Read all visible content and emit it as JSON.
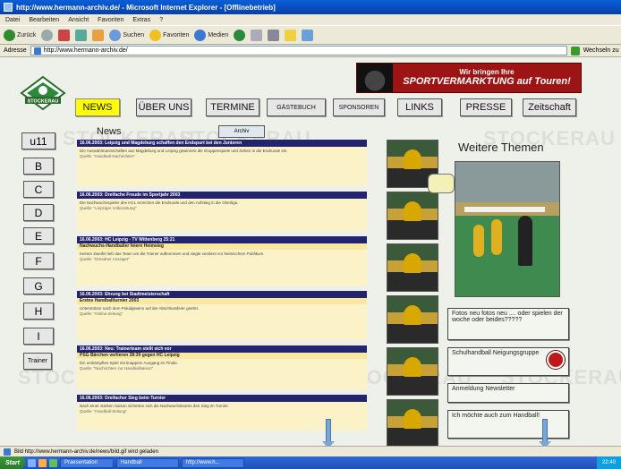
{
  "window": {
    "title": "http://www.hermann-archiv.de/ - Microsoft Internet Explorer - [Offlinebetrieb]",
    "menu": [
      "Datei",
      "Bearbeiten",
      "Ansicht",
      "Favoriten",
      "Extras",
      "?"
    ],
    "toolbar": [
      "Zurück",
      "Suchen",
      "Favoriten",
      "Medien"
    ],
    "address_label": "Adresse",
    "address_value": "http://www.hermann-archiv.de/",
    "links_label": "Wechseln zu"
  },
  "banner": {
    "line1": "Wir bringen Ihre",
    "line2": "SPORTVERMARKTUNG auf Touren!"
  },
  "logo": {
    "text": "STOCKERAU"
  },
  "watermark": "STOCKERAU",
  "nav": [
    "NEWS",
    "ÜBER UNS",
    "TERMINE",
    "GÄSTEBUCH",
    "SPONSOREN",
    "LINKS",
    "PRESSE",
    "Zeitschaft"
  ],
  "sidebar": [
    "u11",
    "B",
    "C",
    "D",
    "E",
    "F",
    "G",
    "H",
    "I",
    "Trainer"
  ],
  "news": {
    "heading": "News",
    "archive_button": "Archiv",
    "items": [
      {
        "head": "16.06.2003: Leipzig und Magdeburg schaffen den Endspurt bei den Junioren",
        "sub": "",
        "body": "Die Auswahlmannschaften aus Magdeburg und Leipzig gewinnen die Gruppenspiele und ziehen in die Endrunde ein.",
        "src": "Quelle: \"Handball-Nachrichten\""
      },
      {
        "head": "16.06.2003: Dreifache Freude im Sportjahr 2003",
        "sub": "",
        "body": "Die Nachwuchsspieler des HCL erreichen die Endrunde und den Aufstieg in die Oberliga.",
        "src": "Quelle: \"Leipziger Volkszeitung\""
      },
      {
        "head": "16.06.2003: HC Leipzig - TV Wittenberg 25:21",
        "sub": "Nachwuchs-Handballer feiern Heimsieg",
        "body": "Keinen Zweifel ließ das Team um die Trainer aufkommen und siegte verdient vor heimischem Publikum.",
        "src": "Quelle: \"Dresdner Anzeiger\""
      },
      {
        "head": "16.06.2003: Ehrung bei Stadtmeisterschaft",
        "sub": "Erstes Handballturnier 2003",
        "body": "Unterstützer nach dem Pokalgewinn auf der Abschlussfeier geehrt.",
        "src": "Quelle: \"Online-Zeitung\""
      },
      {
        "head": "16.06.2003: Neu: Trainerteam stellt sich vor",
        "sub": "PSG Bärchen verlieren 28:30 gegen HC Leipzig",
        "body": "Ein umkämpftes Spiel mit knappem Ausgang im Finale.",
        "src": "Quelle: \"Nachrichten zur Handballsaison\""
      },
      {
        "head": "16.06.2003: Dreifacher Sieg beim Turnier",
        "sub": "",
        "body": "Nach einer starken Saison sicherten sich die Nachwuchsteams den Sieg im Turnier.",
        "src": "Quelle: \"Handball-Zeitung\""
      }
    ]
  },
  "weitere_themen": "Weitere Themen",
  "linkboxes": [
    "Fotos neu fotos neu .... oder spielen der woche oder beides?????",
    "Schulhandball Neigungsgruppe",
    "Anmeldung Newsletter",
    "Ich möchte auch zum Handball!"
  ],
  "statusbar": {
    "text": "Bild http://www.hermann-archiv.de/news/bild.gif wird geladen"
  },
  "taskbar": {
    "start": "Start",
    "tasks": [
      "Praesentation",
      "Handball",
      "http://www.h..."
    ],
    "clock": "22:40"
  }
}
